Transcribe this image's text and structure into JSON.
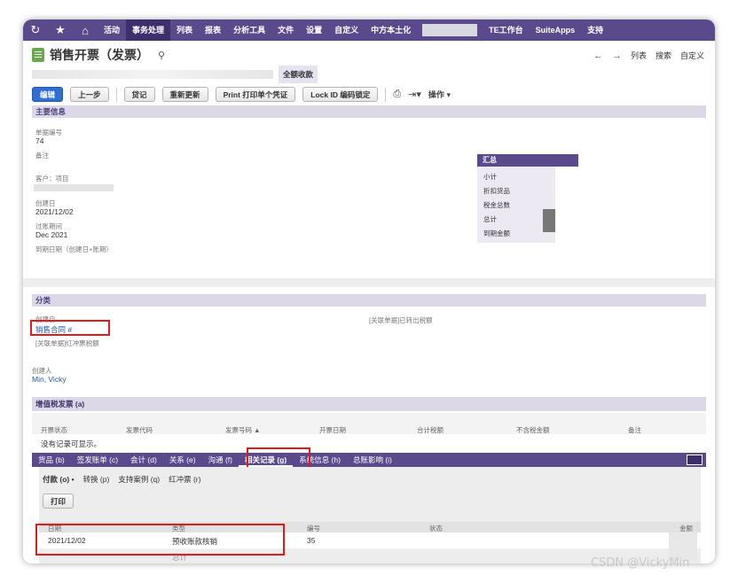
{
  "topnav": {
    "items": [
      "活动",
      "事务处理",
      "列表",
      "报表",
      "分析工具",
      "文件",
      "设置",
      "自定义",
      "中方本土化",
      "TE工作台",
      "SuiteApps",
      "支持"
    ],
    "active": "事务处理"
  },
  "header": {
    "title": "销售开票（发票）",
    "status": "全额收款",
    "links": [
      "列表",
      "搜索",
      "自定义"
    ]
  },
  "toolbar": {
    "edit": "编辑",
    "back": "上一步",
    "credit": "贷记",
    "refresh": "重新更新",
    "print_voucher": "Print 打印单个凭证",
    "lock": "Lock ID 编码锁定",
    "actions": "操作"
  },
  "main_info": {
    "heading": "主要信息",
    "doc_no_label": "单据编号",
    "doc_no": "74",
    "memo_label": "备注",
    "customer_label": "客户：项目",
    "created_label": "创建日",
    "created": "2021/12/02",
    "period_label": "过账期间",
    "period": "Dec 2021",
    "due_label": "到期日期（创建日+账期）"
  },
  "summary": {
    "heading": "汇总",
    "rows": [
      "小计",
      "折扣货品",
      "税金总数",
      "总计",
      "到期金额"
    ]
  },
  "classification": {
    "heading": "分类",
    "created_from_label": "创建自",
    "created_from": "销售合同 #",
    "linked_note_left": "[关联单据]红冲票税额",
    "linked_note_right": "[关联单据]已转出税额",
    "creator_label": "创建人",
    "creator": "Min, Vicky"
  },
  "vat": {
    "heading": "增值税发票 (a)",
    "columns": [
      "开票状态",
      "发票代码",
      "发票号码 ▲",
      "开票日期",
      "合计税额",
      "不含税金额",
      "备注"
    ],
    "empty_text": "没有记录可显示。"
  },
  "subtabs": [
    "货品 (b)",
    "签发账单 (c)",
    "会计 (d)",
    "关系 (e)",
    "沟通 (f)",
    "相关记录 (g)",
    "系统信息 (h)",
    "总账影响 (i)"
  ],
  "subtabs_active": "相关记录 (g)",
  "related": {
    "tabs": [
      "付款 (o) •",
      "转换 (p)",
      "支持案例 (q)",
      "红冲票 (r)"
    ],
    "print": "打印",
    "columns": [
      "日期",
      "类型",
      "编号",
      "状态",
      "金额"
    ],
    "row": {
      "date": "2021/12/02",
      "type": "预收账款核销",
      "number": "35"
    },
    "total_label": "总计"
  },
  "watermark": "CSDN @VickyMin"
}
